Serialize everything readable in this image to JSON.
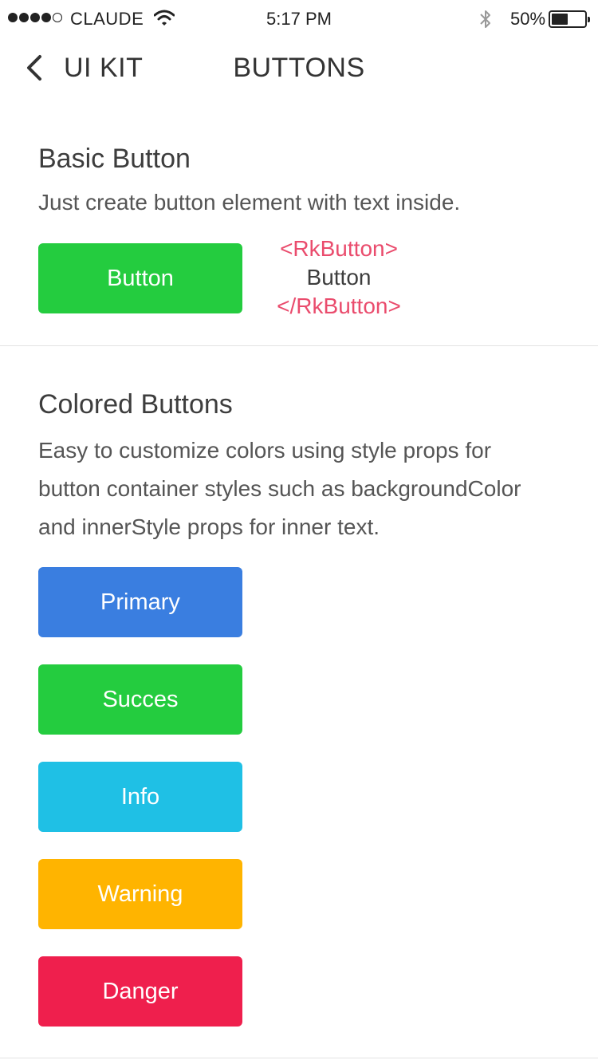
{
  "status_bar": {
    "carrier": "CLAUDE",
    "time": "5:17 PM",
    "battery_percent": "50%",
    "battery_level": 0.5,
    "signal_bars_filled": 4,
    "signal_bars_total": 5
  },
  "nav": {
    "back_label": "UI KIT",
    "title": "BUTTONS"
  },
  "basic": {
    "title": "Basic Button",
    "description": "Just create button element with text inside.",
    "button_label": "Button",
    "button_color": "#24cc3f",
    "code": {
      "open_tag": "<RkButton>",
      "inner": "Button",
      "close_tag": "</RkButton>"
    }
  },
  "colored": {
    "title": "Colored Buttons",
    "description_lines": [
      "Easy to customize colors using style props for",
      "button container styles  such as backgroundColor",
      "and innerStyle props for inner text."
    ],
    "buttons": [
      {
        "label": "Primary",
        "color": "#3a7ee0"
      },
      {
        "label": "Succes",
        "color": "#24cc3f"
      },
      {
        "label": "Info",
        "color": "#1fc0e5"
      },
      {
        "label": "Warning",
        "color": "#ffb400"
      },
      {
        "label": "Danger",
        "color": "#ef1f4d"
      }
    ]
  },
  "colors": {
    "code_tag": "#ea4c6d",
    "divider": "#e3e3e3"
  }
}
